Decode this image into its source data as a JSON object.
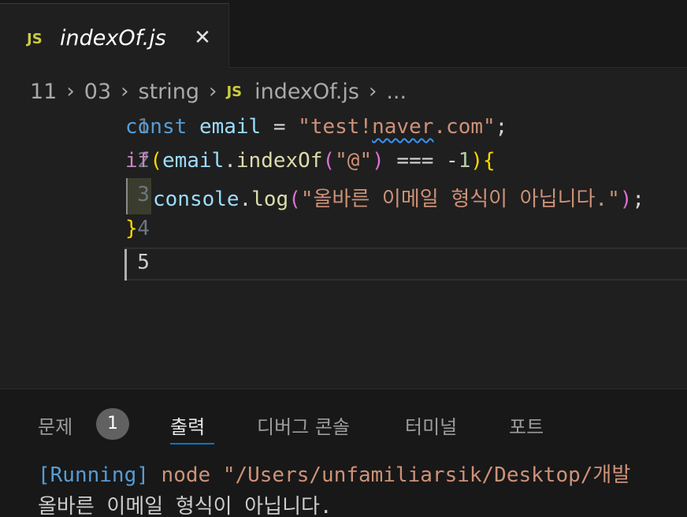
{
  "tab": {
    "icon": "JS",
    "title": "indexOf.js",
    "close": "✕"
  },
  "breadcrumb": {
    "items": [
      "11",
      "03",
      "string",
      "indexOf.js",
      "..."
    ],
    "separator": "›",
    "file_icon": "JS"
  },
  "editor": {
    "line_numbers": [
      "1",
      "2",
      "3",
      "4",
      "5"
    ],
    "active_line": 5,
    "lines": {
      "l1": {
        "kw": "const",
        "var": "email",
        "eq": "=",
        "str_a": "\"test!",
        "str_squiggle": "naver",
        "str_b": ".com\"",
        "semi": ";"
      },
      "l2": {
        "kw": "if",
        "p1": "(",
        "var": "email",
        "dot": ".",
        "fn": "indexOf",
        "p2": "(",
        "str": "\"@\"",
        "p3": ")",
        "op": "===",
        "minus": "-",
        "num": "1",
        "p4": ")",
        "b1": "{"
      },
      "l3": {
        "var": "console",
        "dot": ".",
        "fn": "log",
        "p1": "(",
        "str": "\"올바른 이메일 형식이 아닙니다.\"",
        "p2": ")",
        "semi": ";"
      },
      "l4": {
        "b1": "}"
      }
    }
  },
  "panel": {
    "tabs": [
      "문제",
      "출력",
      "디버그 콘솔",
      "터미널",
      "포트"
    ],
    "active_tab": "출력",
    "problems_count": "1",
    "output": {
      "tag": "[Running]",
      "command": "node \"/Users/unfamiliarsik/Desktop/개발",
      "result": "올바른 이메일 형식이 아닙니다."
    }
  },
  "colors": {
    "keyword": "#569cd6",
    "control": "#c586c0",
    "variable": "#9cdcfe",
    "function": "#dcdcaa",
    "string": "#ce9178",
    "number": "#b5cea8",
    "js_icon": "#cbcb41",
    "accent": "#0078d4"
  }
}
